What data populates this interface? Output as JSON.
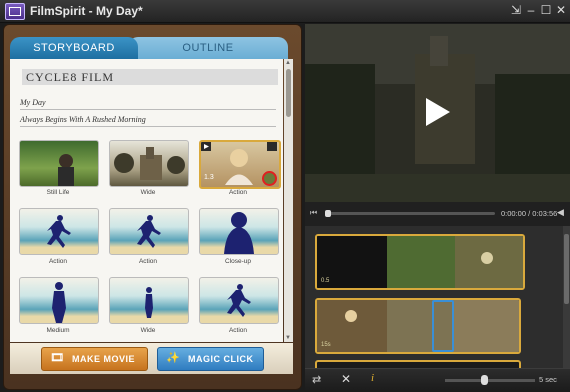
{
  "window": {
    "title": "FilmSpirit - My Day*",
    "controls": [
      "⇲",
      "–",
      "☐",
      "✕"
    ]
  },
  "tabs": [
    {
      "label": "STORYBOARD",
      "active": true
    },
    {
      "label": "OUTLINE",
      "active": false
    }
  ],
  "storyboard": {
    "film_title": "CYCLE8 FILM",
    "field_line1": "My Day",
    "field_line2": "Always Begins With A Rushed Morning",
    "shots": [
      {
        "label": "Still Life"
      },
      {
        "label": "Wide"
      },
      {
        "label": "Action"
      },
      {
        "label": "Action"
      },
      {
        "label": "Action"
      },
      {
        "label": "Close-up"
      },
      {
        "label": "Medium"
      },
      {
        "label": "Wide"
      },
      {
        "label": "Action"
      }
    ],
    "shot_badge": "1.3"
  },
  "buttons": {
    "make_movie": "MAKE MOVIE",
    "magic_click": "MAGIC CLICK"
  },
  "player": {
    "time": "0:00:00 / 0:03:56"
  },
  "timeline": {
    "clip1_duration": "0.5",
    "clip2_duration": "15s",
    "zoom": "5 sec"
  },
  "colors": {
    "accent_tab": "#2a84bd",
    "clip_border": "#d9a93c",
    "selected_clip": "#3a8fd6",
    "alert_ring": "#e02020"
  }
}
